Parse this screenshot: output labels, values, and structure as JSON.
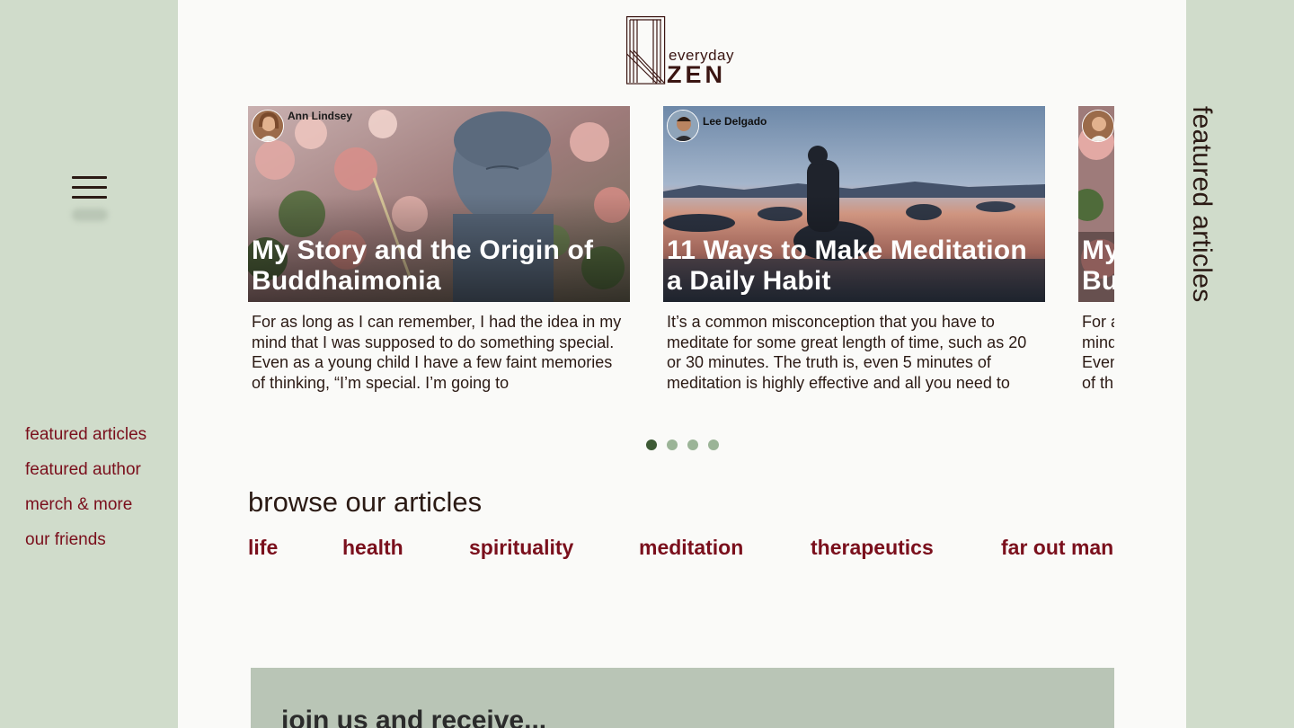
{
  "brand": {
    "logo_line1": "everyday",
    "logo_line2": "ZEN"
  },
  "side_nav": {
    "items": [
      {
        "label": "featured articles"
      },
      {
        "label": "featured author"
      },
      {
        "label": "merch & more"
      },
      {
        "label": "our friends"
      }
    ]
  },
  "right_label": "featured articles",
  "carousel": {
    "cards": [
      {
        "author": "Ann Lindsey",
        "title": "My Story and the Origin of Buddhaimonia",
        "excerpt": "For as long as I can remember, I had the idea in my mind that I was supposed to do something special. Even as a young child I have a few faint memories of thinking, “I’m special. I’m going to"
      },
      {
        "author": "Lee Delgado",
        "title": "11 Ways to Make Meditation a Daily Habit",
        "excerpt": "It’s a common misconception that you have to meditate for some great length of time, such as 20 or 30 minutes. The truth is, even 5 minutes of meditation is highly effective and all you need to"
      },
      {
        "author": "",
        "title": "My Story and the Origin of Buddhaimonia",
        "excerpt": "For as long as I can remember, I had the idea in my mind that I was supposed to do something special. Even as a young child I have a few faint memories of thinking"
      }
    ],
    "page_count": 4,
    "active_page": 1
  },
  "browse": {
    "title": "browse our articles",
    "categories": [
      "life",
      "health",
      "spirituality",
      "meditation",
      "therapeutics",
      "far out man"
    ]
  },
  "join": {
    "title": "join us and receive..."
  },
  "colors": {
    "panel_green": "#d0dccb",
    "page_bg": "#fafaf8",
    "link_red": "#7a0f1c",
    "dot_active": "#3d5a35",
    "dot_inactive": "#9bb497",
    "join_bg": "#b9c5b6"
  }
}
